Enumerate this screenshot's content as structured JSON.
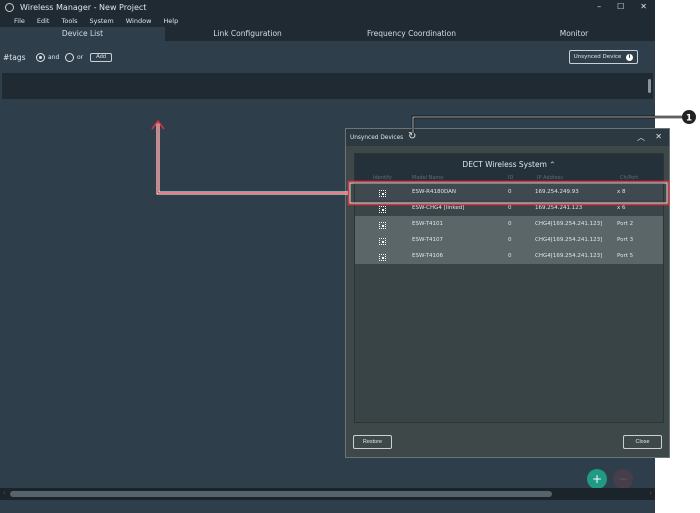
{
  "window": {
    "title": "Wireless Manager - New Project",
    "minimize": "–",
    "maximize": "☐",
    "close": "✕"
  },
  "menu": [
    "File",
    "Edit",
    "Tools",
    "System",
    "Window",
    "Help"
  ],
  "tabs": [
    "Device List",
    "Link Configuration",
    "Frequency Coordination",
    "Monitor"
  ],
  "toolbar": {
    "tags_label": "#tags",
    "and_label": "and",
    "or_label": "or",
    "add_label": "Add",
    "unsynced_label": "Unsynced Device",
    "info_icon": "i"
  },
  "fab": {
    "add": "+",
    "remove": "−"
  },
  "dialog": {
    "title": "Unsynced Devices",
    "group_title": "DECT Wireless System",
    "columns": [
      "Identify",
      "Model Name",
      "ID",
      "IP Address",
      "Ch/Port"
    ],
    "rows": [
      {
        "model": "ESW-R4180DAN",
        "id": "0",
        "ip": "169.254.249.93",
        "port": "x 8"
      },
      {
        "model": "ESW-CHG4 [linked]",
        "id": "0",
        "ip": "169.254.241.123",
        "port": "x 6"
      },
      {
        "model": "ESW-T4101",
        "id": "0",
        "ip": "CHG4[169.254.241.123]",
        "port": "Port 2"
      },
      {
        "model": "ESW-T4107",
        "id": "0",
        "ip": "CHG4[169.254.241.123]",
        "port": "Port 3"
      },
      {
        "model": "ESW-T4106",
        "id": "0",
        "ip": "CHG4[169.254.241.123]",
        "port": "Port 5"
      }
    ],
    "restore_label": "Restore",
    "close_label": "Close"
  },
  "callout": {
    "number": "1"
  },
  "colors": {
    "highlight": "#d9343f",
    "accent": "#1f9a84"
  }
}
